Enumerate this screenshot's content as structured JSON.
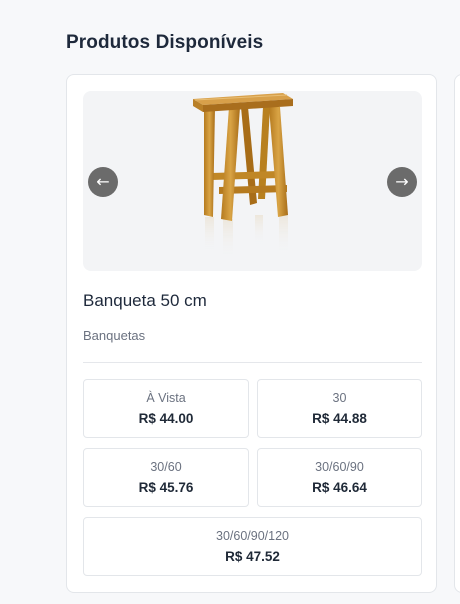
{
  "section": {
    "title": "Produtos Disponíveis"
  },
  "product": {
    "name": "Banqueta 50 cm",
    "category": "Banquetas",
    "image_icon": "wooden-stool-image",
    "prev_icon": "←",
    "next_icon": "→",
    "prices": [
      {
        "plan": "À Vista",
        "amount": "R$ 44.00"
      },
      {
        "plan": "30",
        "amount": "R$ 44.88"
      },
      {
        "plan": "30/60",
        "amount": "R$ 45.76"
      },
      {
        "plan": "30/60/90",
        "amount": "R$ 46.64"
      },
      {
        "plan": "30/60/90/120",
        "amount": "R$ 47.52"
      }
    ]
  },
  "colors": {
    "nav_button": "#6b6b6b",
    "wood": "#c8922f",
    "image_bg": "#f3f4f6"
  }
}
